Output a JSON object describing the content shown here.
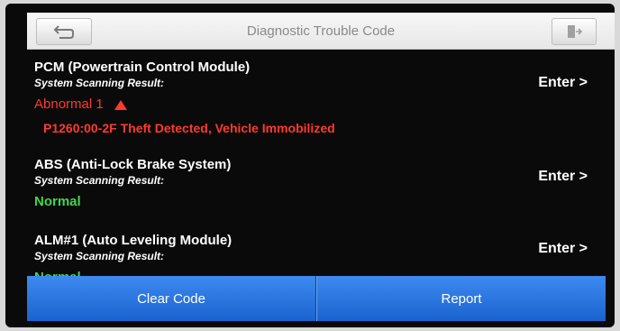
{
  "header": {
    "title": "Diagnostic Trouble Code",
    "back_icon": "back-arrow-icon",
    "exit_icon": "exit-door-icon"
  },
  "modules": [
    {
      "name": "PCM (Powertrain Control Module)",
      "subtitle": "System Scanning Result:",
      "status": "Abnormal 1",
      "dtc": "P1260:00-2F Theft Detected, Vehicle Immobilized",
      "enter": "Enter >"
    },
    {
      "name": "ABS (Anti-Lock Brake System)",
      "subtitle": "System Scanning Result:",
      "status": "Normal",
      "enter": "Enter >"
    },
    {
      "name": "ALM#1 (Auto Leveling Module)",
      "subtitle": "System Scanning Result:",
      "status": "Normal",
      "enter": "Enter >"
    }
  ],
  "footer": {
    "clear_label": "Clear Code",
    "report_label": "Report"
  },
  "colors": {
    "abnormal": "#ff3a2e",
    "normal": "#41d64b",
    "button_blue": "#2a76e0"
  }
}
